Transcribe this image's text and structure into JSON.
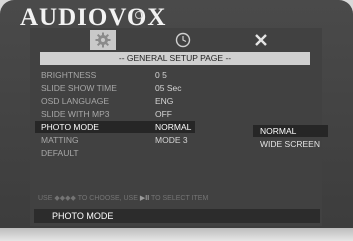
{
  "brand": "AUDIOVOX",
  "colors": {
    "screen_bg": "#414141",
    "highlight": "#262626",
    "title_bar": "#cfcfcf",
    "active_tab": "#c9c9c9"
  },
  "tabs": [
    {
      "icon": "gear-icon",
      "active": true
    },
    {
      "icon": "clock-icon",
      "active": false
    },
    {
      "icon": "close-icon",
      "active": false
    }
  ],
  "page_title": "-- GENERAL SETUP PAGE --",
  "settings": [
    {
      "label": "BRIGHTNESS",
      "value": "0 5"
    },
    {
      "label": "SLIDE SHOW TIME",
      "value": "05 Sec"
    },
    {
      "label": "OSD LANGUAGE",
      "value": "ENG"
    },
    {
      "label": "SLIDE WITH MP3",
      "value": "OFF"
    },
    {
      "label": "PHOTO MODE",
      "value": "NORMAL"
    },
    {
      "label": "MATTING",
      "value": "MODE  3"
    },
    {
      "label": "DEFAULT",
      "value": ""
    }
  ],
  "submenu": {
    "selected": "NORMAL",
    "option": "WIDE SCREEN"
  },
  "hint": {
    "use": "USE",
    "arrows": "◆◆◆◆",
    "to_choose": "TO CHOOSE, USE",
    "play_pause": "▶II",
    "to_select": "TO SELECT ITEM"
  },
  "status": "PHOTO MODE"
}
